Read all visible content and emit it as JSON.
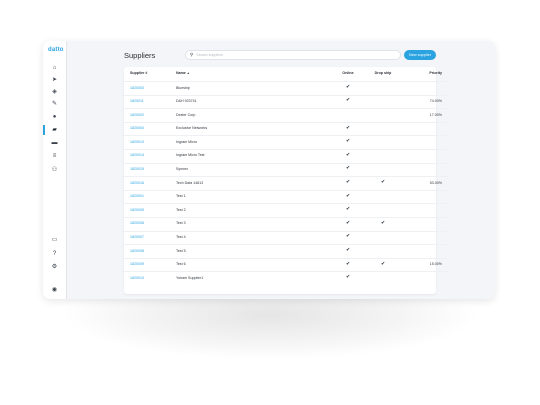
{
  "app": {
    "logo": "datto"
  },
  "sidebar": {
    "icons": [
      {
        "name": "home-icon",
        "glyph": "⌂"
      },
      {
        "name": "send-icon",
        "glyph": "➤"
      },
      {
        "name": "tag-icon",
        "glyph": "◈"
      },
      {
        "name": "pencil-icon",
        "glyph": "✎"
      },
      {
        "name": "user-icon",
        "glyph": "●"
      },
      {
        "name": "folder-icon",
        "glyph": "▰"
      },
      {
        "name": "inbox-icon",
        "glyph": "▬"
      },
      {
        "name": "list-icon",
        "glyph": "≡"
      },
      {
        "name": "users-icon",
        "glyph": "⚇"
      },
      {
        "name": "card-icon",
        "glyph": "▭"
      },
      {
        "name": "help-icon",
        "glyph": "?"
      },
      {
        "name": "settings-icon",
        "glyph": "⚙"
      },
      {
        "name": "account-icon",
        "glyph": "◉"
      }
    ],
    "active_index": 5
  },
  "header": {
    "title": "Suppliers",
    "search_placeholder": "Search suppliers",
    "new_button": "New supplier"
  },
  "table": {
    "columns": [
      "Supplier #",
      "Name",
      "Online",
      "Drop ship",
      "Priority"
    ],
    "sort_indicator": "▲",
    "check_glyph": "✔",
    "rows": [
      {
        "id": "1820003",
        "name": "Blueship",
        "online": true,
        "dropship": false,
        "priority": ""
      },
      {
        "id": "1820011",
        "name": "D&H 923741",
        "online": true,
        "dropship": false,
        "priority": "74.00%"
      },
      {
        "id": "1820002",
        "name": "Dexter Corp",
        "online": false,
        "dropship": false,
        "priority": "17.00%"
      },
      {
        "id": "1820004",
        "name": "Exclusive Networks",
        "online": true,
        "dropship": false,
        "priority": ""
      },
      {
        "id": "1820013",
        "name": "Ingram Micro",
        "online": true,
        "dropship": false,
        "priority": ""
      },
      {
        "id": "1820014",
        "name": "Ingram Micro Test",
        "online": true,
        "dropship": false,
        "priority": ""
      },
      {
        "id": "1820015",
        "name": "Synnex",
        "online": true,
        "dropship": false,
        "priority": ""
      },
      {
        "id": "1820016",
        "name": "Tech Data 14813",
        "online": true,
        "dropship": true,
        "priority": "53.00%"
      },
      {
        "id": "1820001",
        "name": "Test 1",
        "online": true,
        "dropship": false,
        "priority": ""
      },
      {
        "id": "1820005",
        "name": "Test 2",
        "online": true,
        "dropship": false,
        "priority": ""
      },
      {
        "id": "1820006",
        "name": "Test 3",
        "online": true,
        "dropship": true,
        "priority": ""
      },
      {
        "id": "1820007",
        "name": "Test 4",
        "online": true,
        "dropship": false,
        "priority": ""
      },
      {
        "id": "1820008",
        "name": "Test 5",
        "online": true,
        "dropship": false,
        "priority": ""
      },
      {
        "id": "1820009",
        "name": "Test 6",
        "online": true,
        "dropship": true,
        "priority": "15.00%"
      },
      {
        "id": "1820010",
        "name": "Yoham Supplier1",
        "online": true,
        "dropship": false,
        "priority": ""
      }
    ]
  }
}
